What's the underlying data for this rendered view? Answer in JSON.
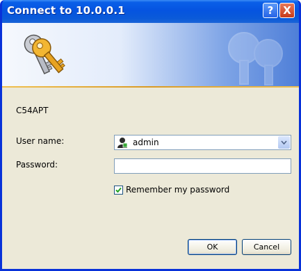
{
  "window": {
    "title": "Connect to 10.0.0.1",
    "help_label": "?",
    "close_label": "X"
  },
  "dialog": {
    "server_name": "C54APT",
    "user_label": "User name:",
    "user_value": "admin",
    "password_label": "Password:",
    "password_value": "",
    "remember_label": "Remember my password",
    "remember_checked": true,
    "ok_label": "OK",
    "cancel_label": "Cancel"
  },
  "icons": {
    "banner": "keys-icon",
    "user": "user-icon",
    "watermark": "keys-watermark-icon"
  },
  "colors": {
    "titlebar": "#0554e0",
    "dialog_bg": "#ece9d8",
    "accent": "#f0c050"
  }
}
